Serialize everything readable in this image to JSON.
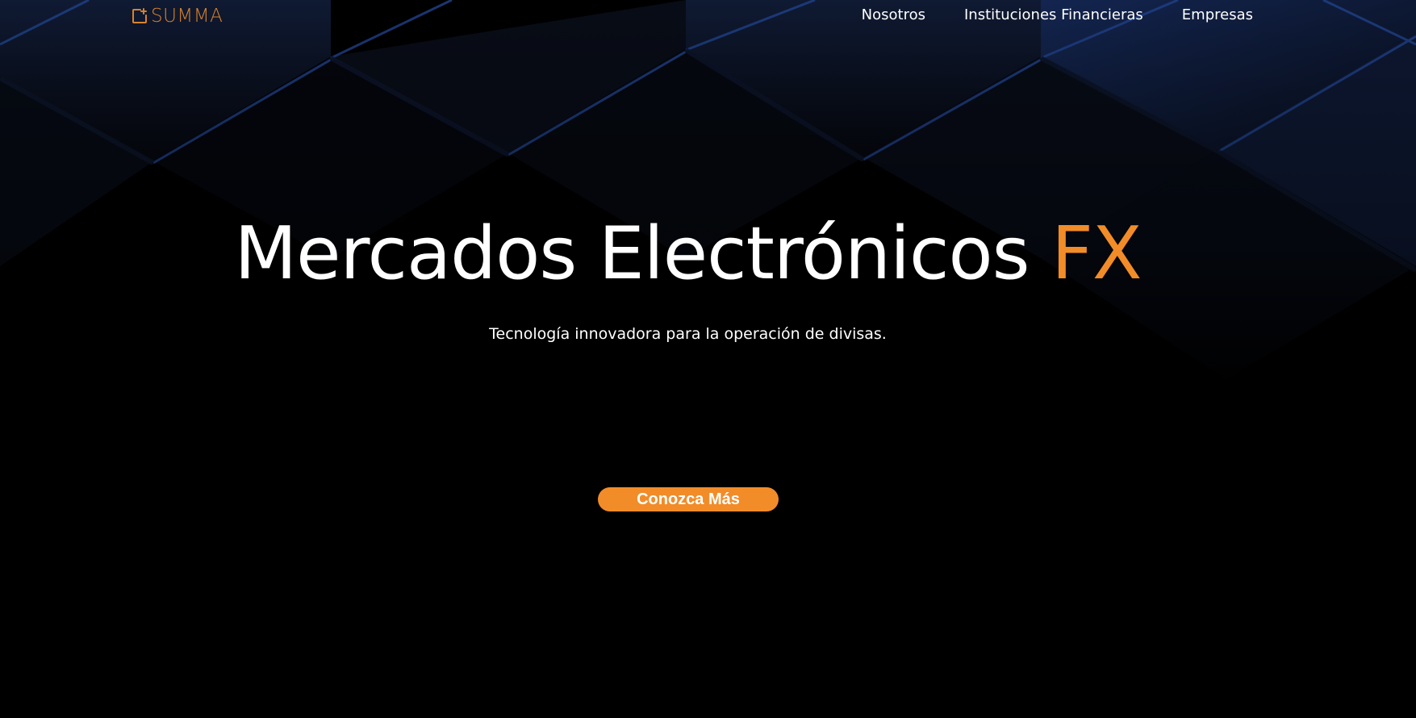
{
  "brand": {
    "name": "SUMMA",
    "icon": "document-plus-icon",
    "color": "#d9822b"
  },
  "nav": {
    "items": [
      {
        "label": "Nosotros"
      },
      {
        "label": "Instituciones Financieras"
      },
      {
        "label": "Empresas"
      }
    ]
  },
  "hero": {
    "title_main": "Mercados Electrónicos",
    "title_accent": "FX",
    "subtitle": "Tecnología innovadora para la operación de divisas.",
    "cta_label": "Conozca Más"
  },
  "colors": {
    "accent": "#f28c28",
    "background": "#000000",
    "pattern_blue": "#1c3a7a"
  }
}
